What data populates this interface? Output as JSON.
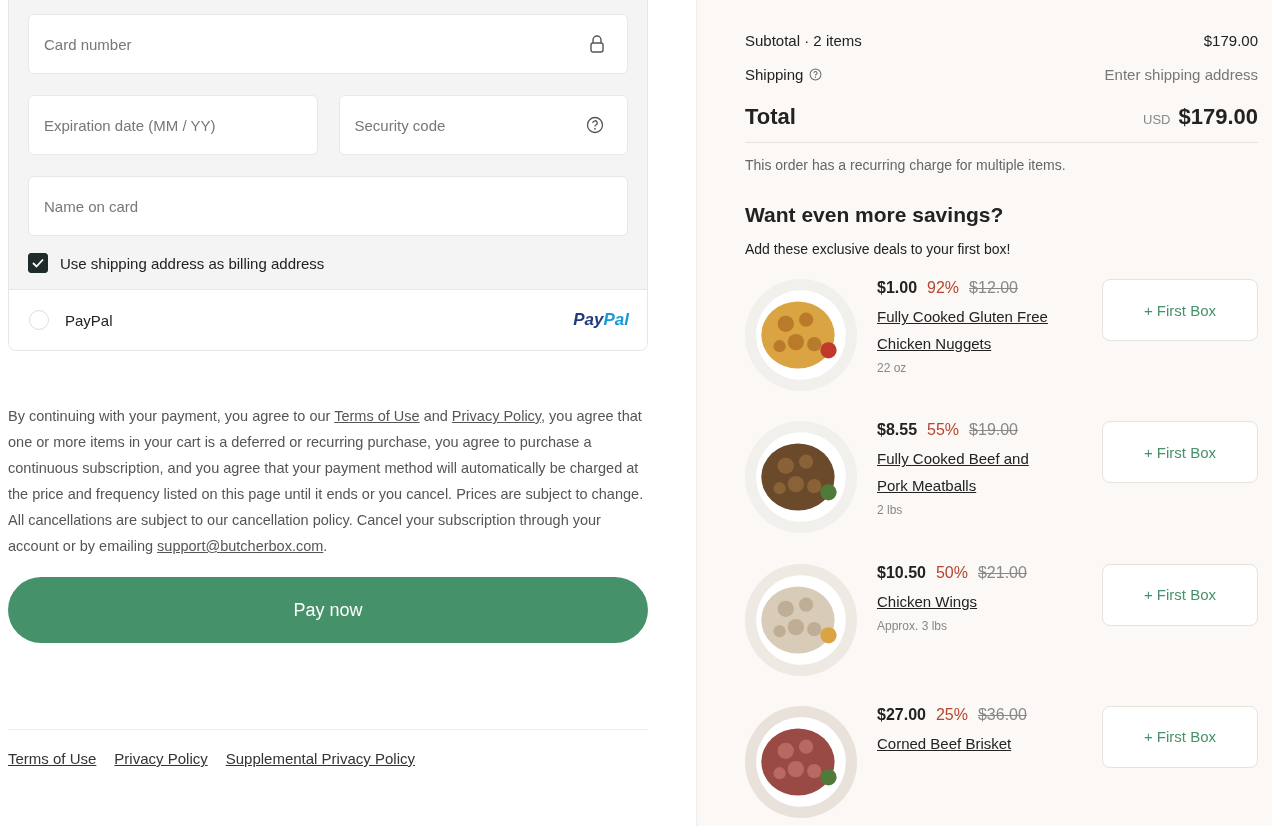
{
  "payment": {
    "fields": [
      {
        "placeholder": "Card number",
        "kind": "lock"
      },
      {
        "placeholder": "Expiration date (MM / YY)"
      },
      {
        "placeholder": "Security code",
        "kind": "help"
      },
      {
        "placeholder": "Name on card"
      }
    ],
    "billing_same": {
      "label": "Use shipping address as billing address",
      "checked": true
    },
    "methods": [
      {
        "label": "PayPal",
        "selected": false,
        "logo": [
          "Pay",
          "Pal"
        ]
      }
    ]
  },
  "legal": [
    {
      "kind": "text",
      "text": "By continuing with your payment, you agree to our "
    },
    {
      "kind": "link",
      "text": "Terms of Use"
    },
    {
      "kind": "text",
      "text": " and "
    },
    {
      "kind": "link",
      "text": "Privacy Policy"
    },
    {
      "kind": "text",
      "text": ", you agree that one or more items in your cart is a deferred or recurring purchase, you agree to purchase a continuous subscription, and you agree that your payment method will automatically be charged at the price and frequency listed on this page until it ends or you cancel. Prices are subject to change. All cancellations are subject to our cancellation policy. Cancel your subscription through your account or by emailing "
    },
    {
      "kind": "link",
      "text": "support@butcherbox.com"
    },
    {
      "kind": "text",
      "text": "."
    }
  ],
  "pay_button": "Pay now",
  "footer_links": [
    "Terms of Use",
    "Privacy Policy",
    "Supplemental Privacy Policy"
  ],
  "summary": {
    "subtotal_label": "Subtotal · 2 items",
    "subtotal": "$179.00",
    "shipping_label": "Shipping",
    "shipping_value": "Enter shipping address",
    "total_label": "Total",
    "currency": "USD",
    "total": "$179.00",
    "note": "This order has a recurring charge for multiple items."
  },
  "upsell": {
    "title": "Want even more savings?",
    "subtitle": "Add these exclusive deals to your first box!",
    "products": [
      {
        "price": "$1.00",
        "discount": "92%",
        "old_price": "$12.00",
        "name": "Fully Cooked Gluten Free Chicken Nuggets",
        "size": "22 oz",
        "button": "+ First Box"
      },
      {
        "price": "$8.55",
        "discount": "55%",
        "old_price": "$19.00",
        "name": "Fully Cooked Beef and Pork Meatballs",
        "size": "2 lbs",
        "button": "+ First Box"
      },
      {
        "price": "$10.50",
        "discount": "50%",
        "old_price": "$21.00",
        "name": "Chicken Wings",
        "size": "Approx. 3 lbs",
        "button": "+ First Box"
      },
      {
        "price": "$27.00",
        "discount": "25%",
        "old_price": "$36.00",
        "name": "Corned Beef Brisket",
        "button": "+ First Box"
      }
    ]
  }
}
